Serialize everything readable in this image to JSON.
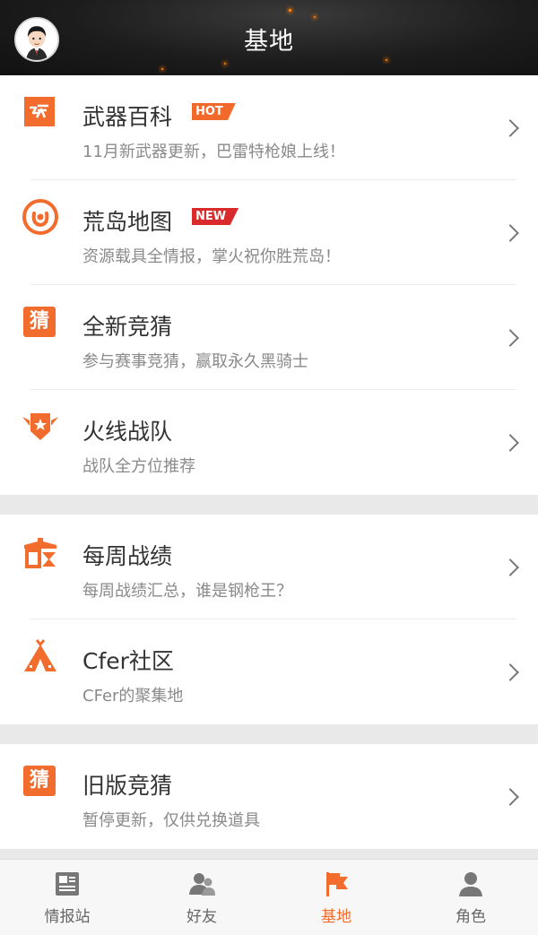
{
  "header": {
    "title": "基地"
  },
  "menu_groups": [
    {
      "items": [
        {
          "title": "武器百科",
          "subtitle": "11月新武器更新，巴雷特枪娘上线！",
          "badge": "HOT"
        },
        {
          "title": "荒岛地图",
          "subtitle": "资源载具全情报，掌火祝你胜荒岛！",
          "badge": "NEW"
        },
        {
          "title": "全新竞猜",
          "subtitle": "参与赛事竞猜，赢取永久黑骑士"
        },
        {
          "title": "火线战队",
          "subtitle": "战队全方位推荐"
        }
      ]
    },
    {
      "items": [
        {
          "title": "每周战绩",
          "subtitle": "每周战绩汇总，谁是钢枪王？"
        },
        {
          "title": "Cfer社区",
          "subtitle": "CFer的聚集地"
        }
      ]
    },
    {
      "items": [
        {
          "title": "旧版竞猜",
          "subtitle": "暂停更新，仅供兑换道具"
        }
      ]
    }
  ],
  "icons": {
    "guess_char": "猜"
  },
  "tabbar": {
    "tabs": [
      {
        "label": "情报站",
        "icon": "news-icon"
      },
      {
        "label": "好友",
        "icon": "friends-icon"
      },
      {
        "label": "基地",
        "icon": "flag-icon",
        "active": true
      },
      {
        "label": "角色",
        "icon": "person-icon"
      }
    ]
  },
  "colors": {
    "accent": "#f26c2d",
    "hot_badge": "#f16a2c",
    "new_badge": "#d92b2b",
    "header_bg": "#1c1c1c",
    "tab_inactive": "#666666"
  }
}
